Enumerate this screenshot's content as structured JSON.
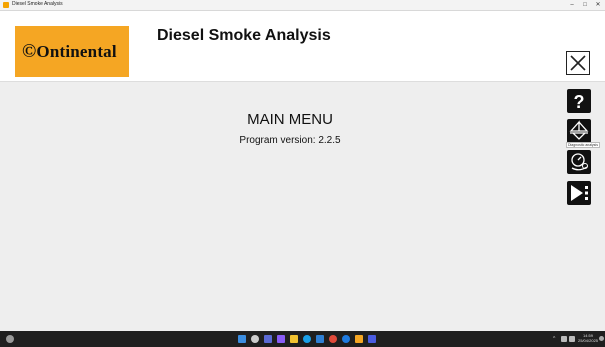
{
  "window": {
    "title": "Diesel Smoke Analysis",
    "controls": {
      "minimize": "–",
      "maximize": "□",
      "close": "✕"
    }
  },
  "header": {
    "logo_text": "Ontinental",
    "title": "Diesel Smoke Analysis",
    "close_icon": "close-icon",
    "brand_color": "#f5a623"
  },
  "main": {
    "menu_title": "MAIN MENU",
    "version_text": "Program version: 2.2.5"
  },
  "sidebar": {
    "buttons": [
      {
        "name": "help-button",
        "icon": "question-icon"
      },
      {
        "name": "diagnostic-button",
        "icon": "network-icon",
        "tooltip": "Diagnostic analysis"
      },
      {
        "name": "gauge-button",
        "icon": "gauge-icon"
      },
      {
        "name": "run-button",
        "icon": "play-icon"
      }
    ]
  },
  "taskbar": {
    "time": "14:59",
    "date": "25/04/2025",
    "tray_chevron": "^"
  }
}
